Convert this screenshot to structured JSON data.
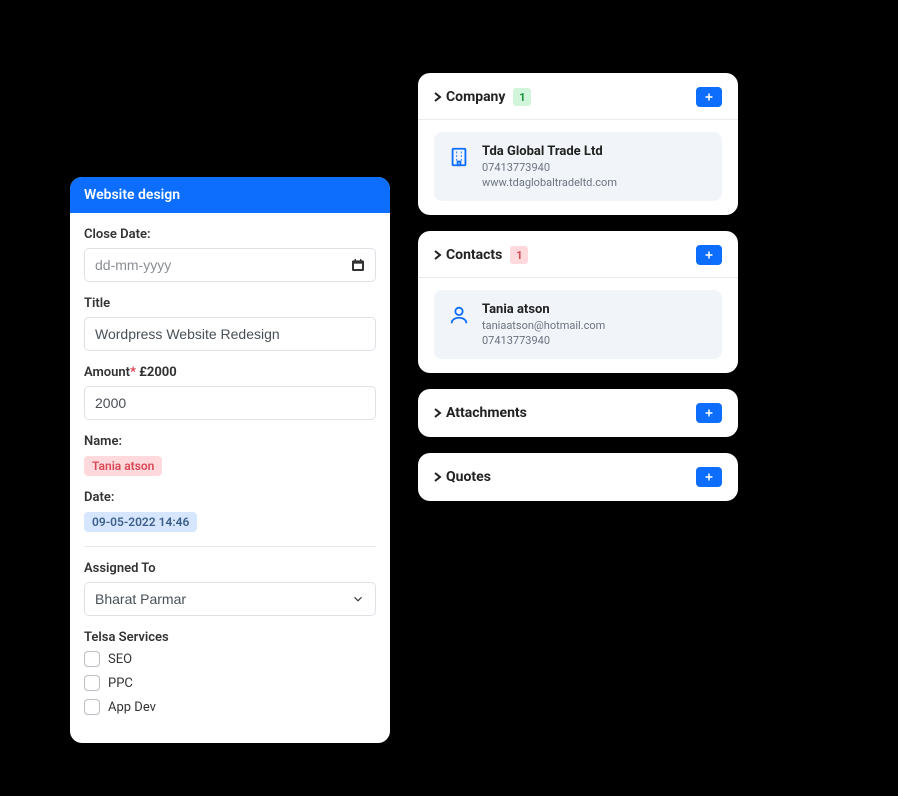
{
  "form": {
    "header": "Website design",
    "close_date_label": "Close Date:",
    "close_date_placeholder": "dd-mm-yyyy",
    "title_label": "Title",
    "title_value": "Wordpress Website Redesign",
    "amount_label": "Amount",
    "amount_suffix": "£2000",
    "amount_value": "2000",
    "name_label": "Name:",
    "name_value": "Tania atson",
    "date_label": "Date:",
    "date_value": "09-05-2022 14:46",
    "assigned_label": "Assigned To",
    "assigned_value": "Bharat Parmar",
    "services_label": "Telsa Services",
    "services": [
      {
        "label": "SEO"
      },
      {
        "label": "PPC"
      },
      {
        "label": "App Dev"
      }
    ]
  },
  "company": {
    "title": "Company",
    "count": "1",
    "name": "Tda Global Trade Ltd",
    "phone": "07413773940",
    "website": "www.tdaglobaltradeltd.com"
  },
  "contacts": {
    "title": "Contacts",
    "count": "1",
    "name": "Tania atson",
    "email": "taniaatson@hotmail.com",
    "phone": "07413773940"
  },
  "attachments": {
    "title": "Attachments"
  },
  "quotes": {
    "title": "Quotes"
  }
}
